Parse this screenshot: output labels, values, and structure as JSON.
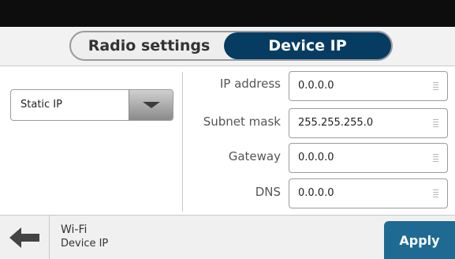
{
  "tabs": [
    {
      "label": "Radio settings",
      "active": false
    },
    {
      "label": "Device IP",
      "active": true
    }
  ],
  "ip_mode": {
    "selected": "Static IP"
  },
  "fields": {
    "ip_address": {
      "label": "IP address",
      "value": "0.0.0.0"
    },
    "subnet_mask": {
      "label": "Subnet mask",
      "value": "255.255.255.0"
    },
    "gateway": {
      "label": "Gateway",
      "value": "0.0.0.0"
    },
    "dns": {
      "label": "DNS",
      "value": "0.0.0.0"
    }
  },
  "breadcrumb": {
    "parent": "Wi-Fi",
    "current": "Device IP"
  },
  "actions": {
    "apply_label": "Apply"
  },
  "icons": {
    "back": "arrow-left-icon",
    "dropdown": "caret-down-icon",
    "field_grip": "grip-icon"
  },
  "colors": {
    "active_tab": "#073c62",
    "apply_button": "#1f6a93",
    "top_bar": "#0d0d0d"
  }
}
